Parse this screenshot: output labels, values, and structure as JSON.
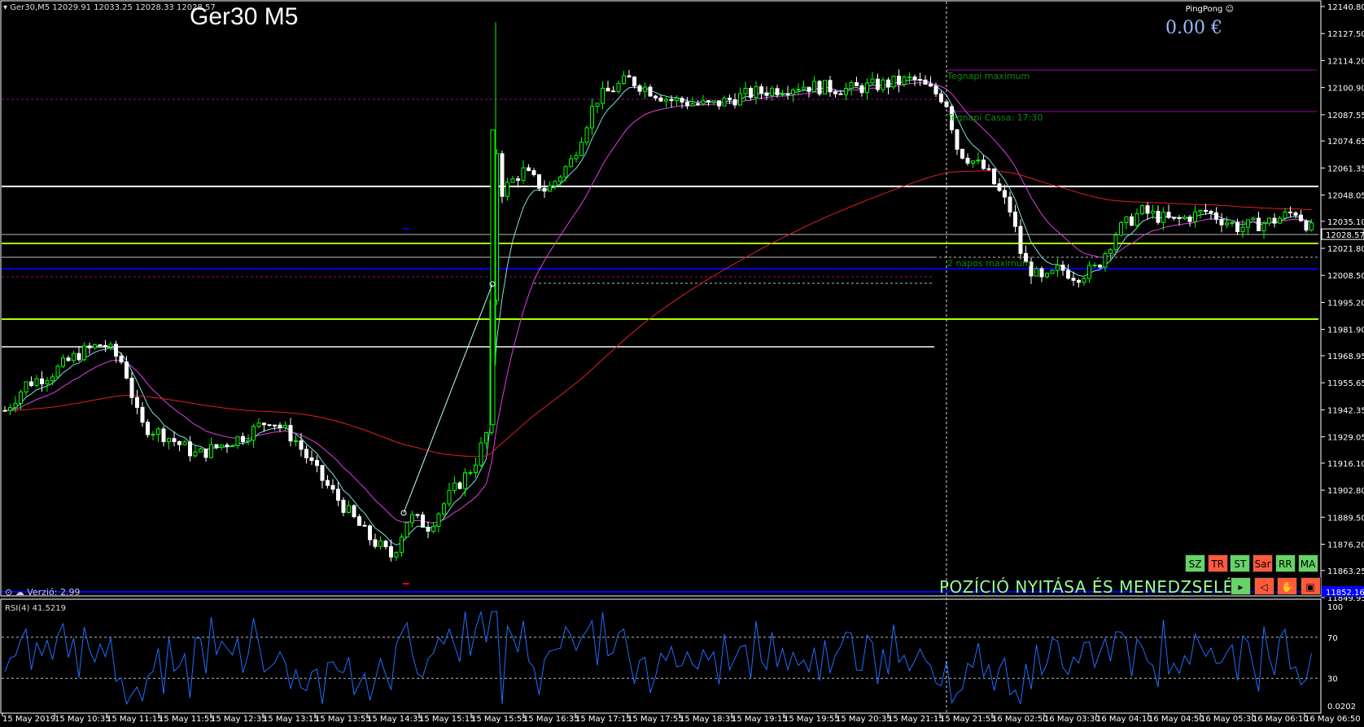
{
  "header": {
    "symbol_line": "Ger30,M5  12029.91 12033.25 12028.33 12028.57",
    "symbol_title": "Ger30 M5",
    "ea_name": "PingPong",
    "profit": "0.00 €",
    "version": "Verzió: 2.99"
  },
  "levels": {
    "yesterday_max": "Tegnapi maximum",
    "yesterday_close": "Tegnapi Cassa: 17:30",
    "two_day_max": "2 napos maximum"
  },
  "panel": {
    "title": "POZÍCIÓ NYITÁSA ÉS MENEDZSELÉS",
    "buttons_top": [
      {
        "label": "SZ",
        "color": "green"
      },
      {
        "label": "TR",
        "color": "red"
      },
      {
        "label": "ST",
        "color": "green"
      },
      {
        "label": "Sar",
        "color": "red"
      },
      {
        "label": "RR",
        "color": "green"
      },
      {
        "label": "MA",
        "color": "green"
      }
    ],
    "buttons_bottom": [
      {
        "label": "▸",
        "name": "play-icon",
        "color": "green"
      },
      {
        "label": "◁",
        "name": "arrow-left-icon",
        "color": "red"
      },
      {
        "label": "✋",
        "name": "hand-icon",
        "color": "red"
      },
      {
        "label": "▣",
        "name": "windows-icon",
        "color": "red"
      }
    ]
  },
  "price_axis": {
    "labels": [
      "12140.80",
      "12127.50",
      "12114.20",
      "12100.90",
      "12087.55",
      "12074.65",
      "12061.35",
      "12048.05",
      "12035.10",
      "12021.80",
      "12008.50",
      "11995.20",
      "11981.90",
      "11968.95",
      "11955.65",
      "11942.35",
      "11929.05",
      "11916.10",
      "11902.80",
      "11889.50",
      "11876.20",
      "11863.25",
      "11849.95"
    ],
    "current_price": "12028.57",
    "blue_level_tag": "11852.16"
  },
  "rsi": {
    "label": "RSI(4) 41.5219",
    "levels": [
      "100",
      "70",
      "30",
      "0.0202"
    ]
  },
  "time_axis": [
    "15 May 2019",
    "15 May 10:35",
    "15 May 11:15",
    "15 May 11:55",
    "15 May 12:35",
    "15 May 13:15",
    "15 May 13:55",
    "15 May 14:35",
    "15 May 15:15",
    "15 May 15:55",
    "15 May 16:35",
    "15 May 17:15",
    "15 May 17:55",
    "15 May 18:35",
    "15 May 19:15",
    "15 May 19:55",
    "15 May 20:35",
    "15 May 21:15",
    "15 May 21:55",
    "16 May 02:50",
    "16 May 03:30",
    "16 May 04:10",
    "16 May 04:50",
    "16 May 05:30",
    "16 May 06:10",
    "16 May 06:50"
  ],
  "colors": {
    "bull": "#00ff00",
    "bear": "#ffffff",
    "ma_fast": "#7fdfdf",
    "ma_mid": "#e040e0",
    "ma_slow": "#e02020",
    "rsi_line": "#1e6fff",
    "level_green": "#aaff00",
    "level_white": "#ffffff",
    "level_blue": "#0000ff",
    "level_purple": "#a000a0"
  }
}
